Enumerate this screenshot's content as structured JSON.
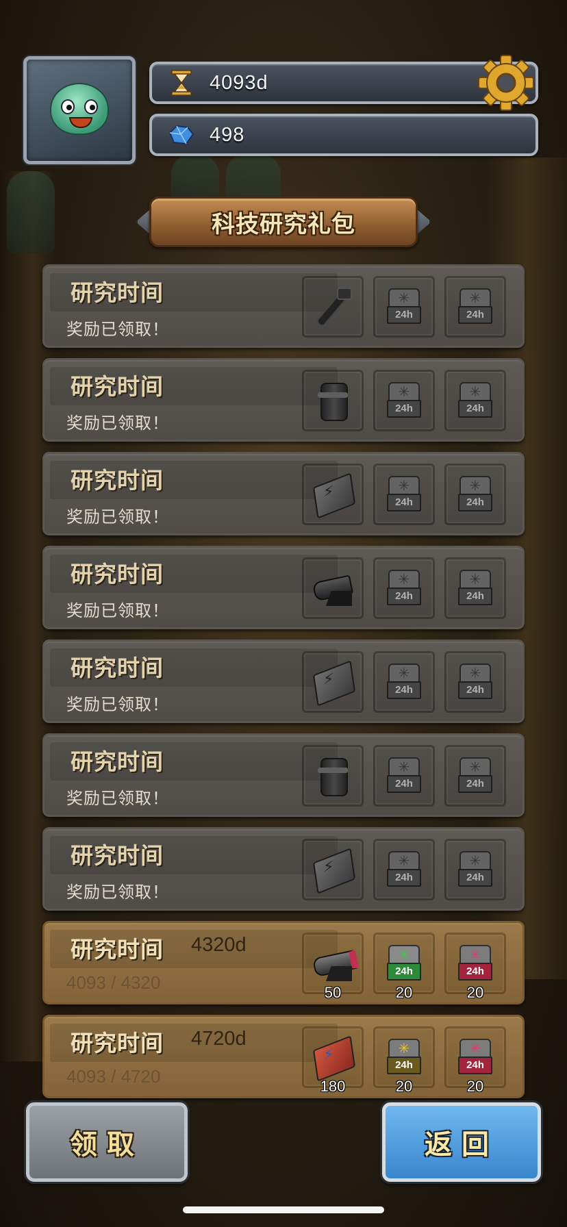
{
  "hud": {
    "time_value": "4093d",
    "gem_value": "498"
  },
  "banner": {
    "title": "科技研究礼包"
  },
  "rows": [
    {
      "title": "研究时间",
      "status": "奖励已领取！",
      "item": "wrench"
    },
    {
      "title": "研究时间",
      "status": "奖励已领取！",
      "item": "canister"
    },
    {
      "title": "研究时间",
      "status": "奖励已领取！",
      "item": "chip"
    },
    {
      "title": "研究时间",
      "status": "奖励已领取！",
      "item": "cannon"
    },
    {
      "title": "研究时间",
      "status": "奖励已领取！",
      "item": "chip"
    },
    {
      "title": "研究时间",
      "status": "奖励已领取！",
      "item": "canister"
    },
    {
      "title": "研究时间",
      "status": "奖励已领取！",
      "item": "chip"
    },
    {
      "title": "研究时间",
      "target": "4320d",
      "progress": "4093 / 4320",
      "item": "cannon",
      "rewards": {
        "item_count": "50",
        "boost1": "20",
        "boost2": "20"
      }
    },
    {
      "title": "研究时间",
      "target": "4720d",
      "progress": "4093 / 4720",
      "item": "chip-red",
      "rewards": {
        "item_count": "180",
        "boost1": "20",
        "boost2": "20"
      }
    }
  ],
  "boost_label": "24h",
  "buttons": {
    "claim": "领取",
    "back": "返回"
  },
  "icons": {
    "time": "hourglass-icon",
    "gem": "blue-gem-icon",
    "settings": "gear-icon"
  }
}
